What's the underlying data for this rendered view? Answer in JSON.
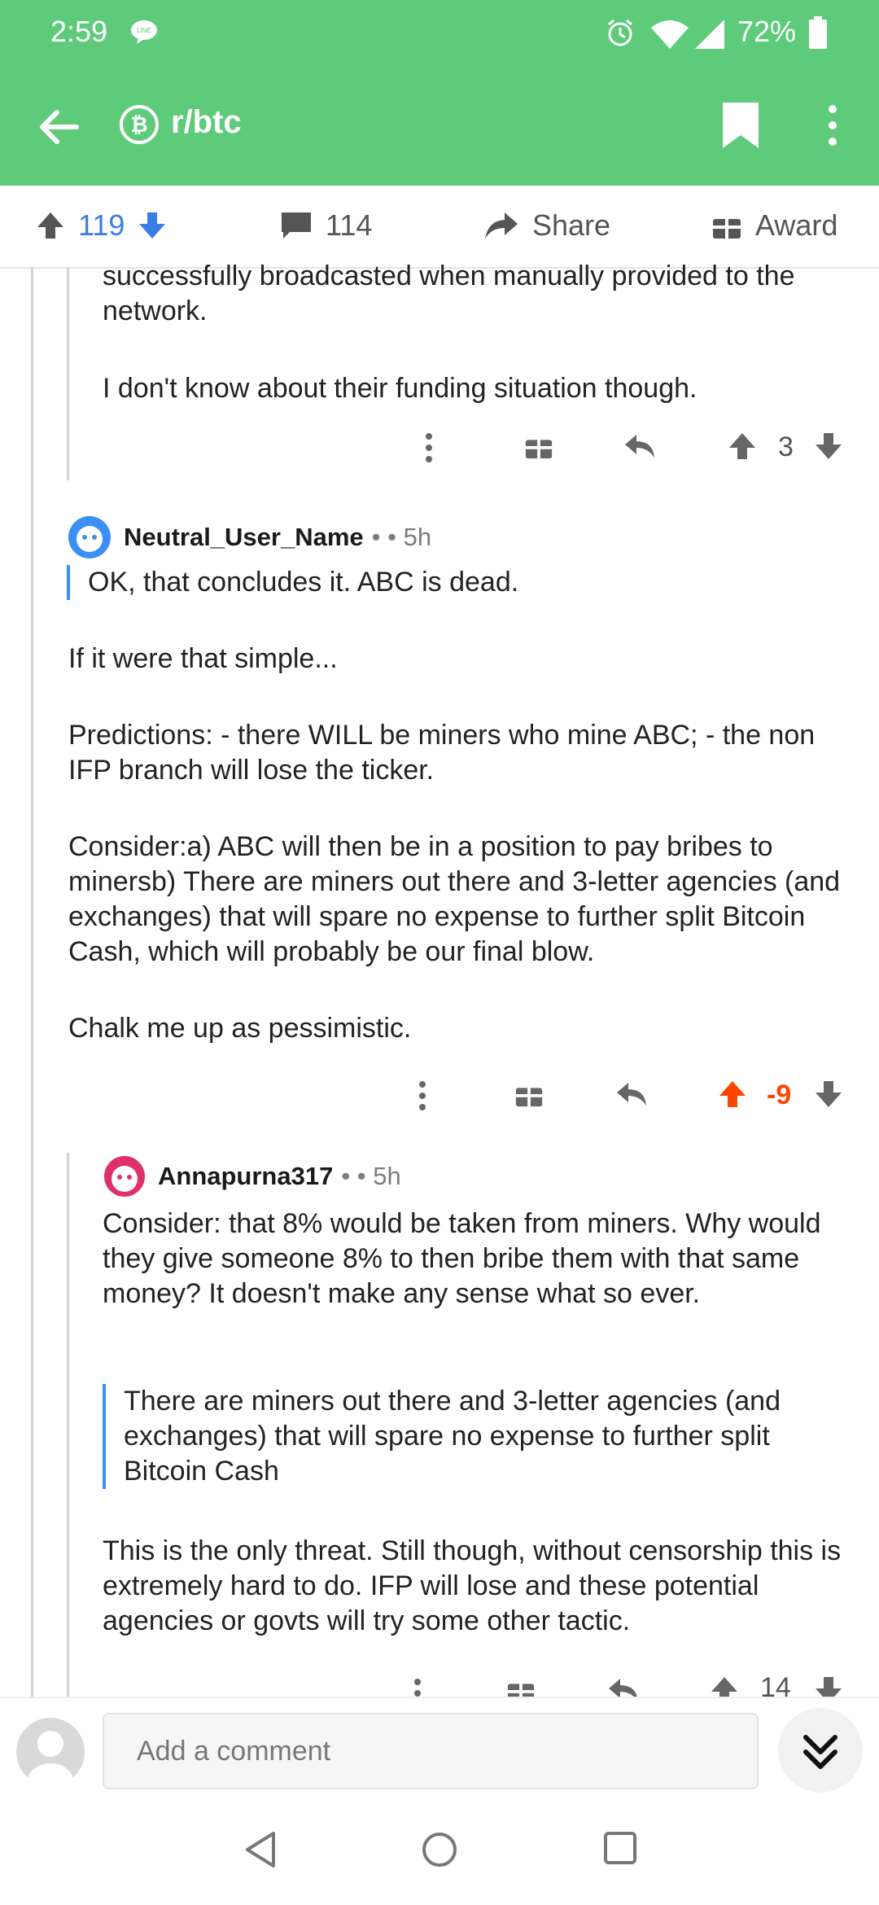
{
  "status_bar": {
    "time": "2:59",
    "battery": "72%"
  },
  "app_bar": {
    "subreddit": "r/btc"
  },
  "post_actions": {
    "upvotes": "119",
    "comments": "114",
    "share": "Share",
    "award": "Award"
  },
  "comments": [
    {
      "text_lines": [
        "successfully broadcasted when manually provided to the",
        "network.",
        "",
        "I don't know about their funding situation though."
      ],
      "score": "3"
    },
    {
      "author": "Neutral_User_Name",
      "meta": "• • 5h",
      "quote": "OK, that concludes it. ABC is dead.",
      "paragraphs": [
        "If it were that simple...",
        "Predictions: - there WILL be miners who mine ABC; - the non IFP branch will lose the ticker.",
        "Consider:a) ABC will then be in a position to pay bribes to minersb) There are miners out there and 3-letter agencies (and exchanges) that will spare no expense to further split Bitcoin Cash, which will probably be our final blow.",
        "Chalk me up as pessimistic."
      ],
      "score": "-9"
    },
    {
      "author": "Annapurna317",
      "meta": "• • 5h",
      "paragraphs": [
        "Consider: that 8% would be taken from miners. Why would they give someone 8% to then bribe them with that same money? It doesn't make any sense what so ever."
      ],
      "quote": "There are miners out there and 3-letter agencies (and exchanges) that will spare no expense to further split Bitcoin Cash",
      "after_quote": "This is the only threat. Still though, without censorship this is extremely hard to do. IFP will lose and these potential agencies or govts will try some other tactic.",
      "score": "14"
    }
  ],
  "composer": {
    "placeholder": "Add a comment"
  },
  "colors": {
    "brand_green": "#5ecb7a",
    "upvote_blue": "#3b7de8",
    "downvote_orange": "#ff4500"
  }
}
